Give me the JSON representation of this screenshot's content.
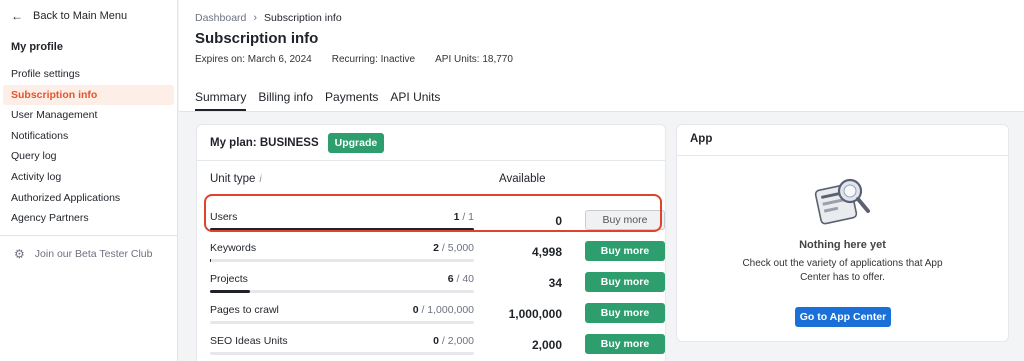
{
  "sidebar": {
    "back_label": "Back to Main Menu",
    "section_title": "My profile",
    "items": [
      {
        "label": "Profile settings"
      },
      {
        "label": "Subscription info"
      },
      {
        "label": "User Management"
      },
      {
        "label": "Notifications"
      },
      {
        "label": "Query log"
      },
      {
        "label": "Activity log"
      },
      {
        "label": "Authorized Applications"
      },
      {
        "label": "Agency Partners"
      }
    ],
    "beta_label": "Join our Beta Tester Club"
  },
  "header": {
    "breadcrumb": [
      "Dashboard",
      "Subscription info"
    ],
    "title": "Subscription info",
    "meta": [
      "Expires on: March 6, 2024",
      "Recurring: Inactive",
      "API Units: 18,770"
    ],
    "tabs": [
      "Summary",
      "Billing info",
      "Payments",
      "API Units"
    ]
  },
  "plan": {
    "title": "My plan: BUSINESS",
    "upgrade_label": "Upgrade",
    "col_unit": "Unit type",
    "col_unit_info": "i",
    "col_available": "Available",
    "rows": [
      {
        "name": "Users",
        "used": "1",
        "limit": " / 1",
        "available": "0",
        "buy": "Buy more",
        "fill": 1.0
      },
      {
        "name": "Keywords",
        "used": "2",
        "limit": " / 5,000",
        "available": "4,998",
        "buy": "Buy more",
        "fill": 0.0004
      },
      {
        "name": "Projects",
        "used": "6",
        "limit": " / 40",
        "available": "34",
        "buy": "Buy more",
        "fill": 0.15
      },
      {
        "name": "Pages to crawl",
        "used": "0",
        "limit": " / 1,000,000",
        "available": "1,000,000",
        "buy": "Buy more",
        "fill": 0
      },
      {
        "name": "SEO Ideas Units",
        "used": "0",
        "limit": " / 2,000",
        "available": "2,000",
        "buy": "Buy more",
        "fill": 0
      }
    ]
  },
  "app": {
    "title": "App",
    "empty_title": "Nothing here yet",
    "empty_desc": "Check out the variety of applications that App Center has to offer.",
    "button_label": "Go to App Center"
  },
  "colors": {
    "accent_green": "#2e9e6e",
    "active_orange": "#e2552e",
    "primary_blue": "#1b6fd9",
    "highlight_red": "#e0432b"
  }
}
